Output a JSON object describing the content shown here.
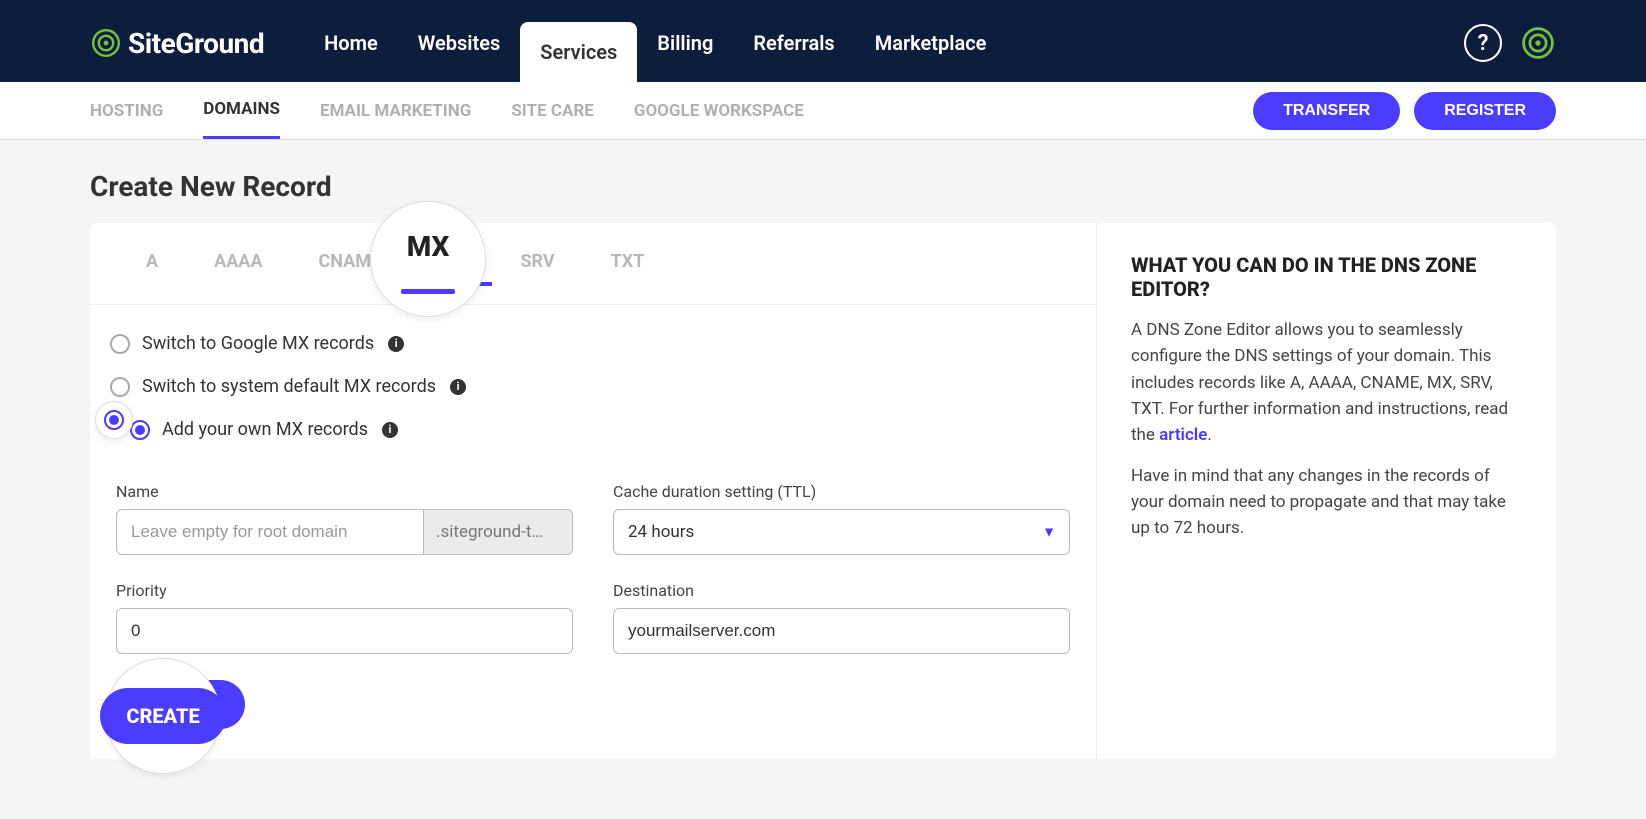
{
  "brand": "SiteGround",
  "mainnav": [
    {
      "label": "Home",
      "active": false
    },
    {
      "label": "Websites",
      "active": false
    },
    {
      "label": "Services",
      "active": true
    },
    {
      "label": "Billing",
      "active": false
    },
    {
      "label": "Referrals",
      "active": false
    },
    {
      "label": "Marketplace",
      "active": false
    }
  ],
  "help_char": "?",
  "subnav": [
    {
      "label": "HOSTING",
      "active": false
    },
    {
      "label": "DOMAINS",
      "active": true
    },
    {
      "label": "EMAIL MARKETING",
      "active": false
    },
    {
      "label": "SITE CARE",
      "active": false
    },
    {
      "label": "GOOGLE WORKSPACE",
      "active": false
    }
  ],
  "sub_actions": {
    "transfer": "TRANSFER",
    "register": "REGISTER"
  },
  "page_title": "Create New Record",
  "rectabs": [
    {
      "label": "A",
      "active": false
    },
    {
      "label": "AAAA",
      "active": false
    },
    {
      "label": "CNAME",
      "active": false
    },
    {
      "label": "MX",
      "active": true
    },
    {
      "label": "SRV",
      "active": false
    },
    {
      "label": "TXT",
      "active": false
    }
  ],
  "mx_magnify_label": "MX",
  "radios": [
    {
      "label": "Switch to Google MX records",
      "selected": false,
      "info": true
    },
    {
      "label": "Switch to system default MX records",
      "selected": false,
      "info": true
    },
    {
      "label": "Add your own MX records",
      "selected": true,
      "info": true
    }
  ],
  "form": {
    "name_label": "Name",
    "name_placeholder": "Leave empty for root domain",
    "name_value": "",
    "name_suffix": ".siteground-t…",
    "ttl_label": "Cache duration setting (TTL)",
    "ttl_value": "24 hours",
    "priority_label": "Priority",
    "priority_value": "0",
    "destination_label": "Destination",
    "destination_value": "yourmailserver.com",
    "create_label": "CREATE"
  },
  "sidepanel": {
    "title": "WHAT YOU CAN DO IN THE DNS ZONE EDITOR?",
    "p1a": "A DNS Zone Editor allows you to seamlessly configure the DNS settings of your domain. This includes records like A, AAAA, CNAME, MX, SRV, TXT. For further information and instructions, read the ",
    "p1_link": "article",
    "p1b": ".",
    "p2": "Have in mind that any changes in the records of your domain need to propagate and that may take up to 72 hours."
  },
  "info_char": "i"
}
